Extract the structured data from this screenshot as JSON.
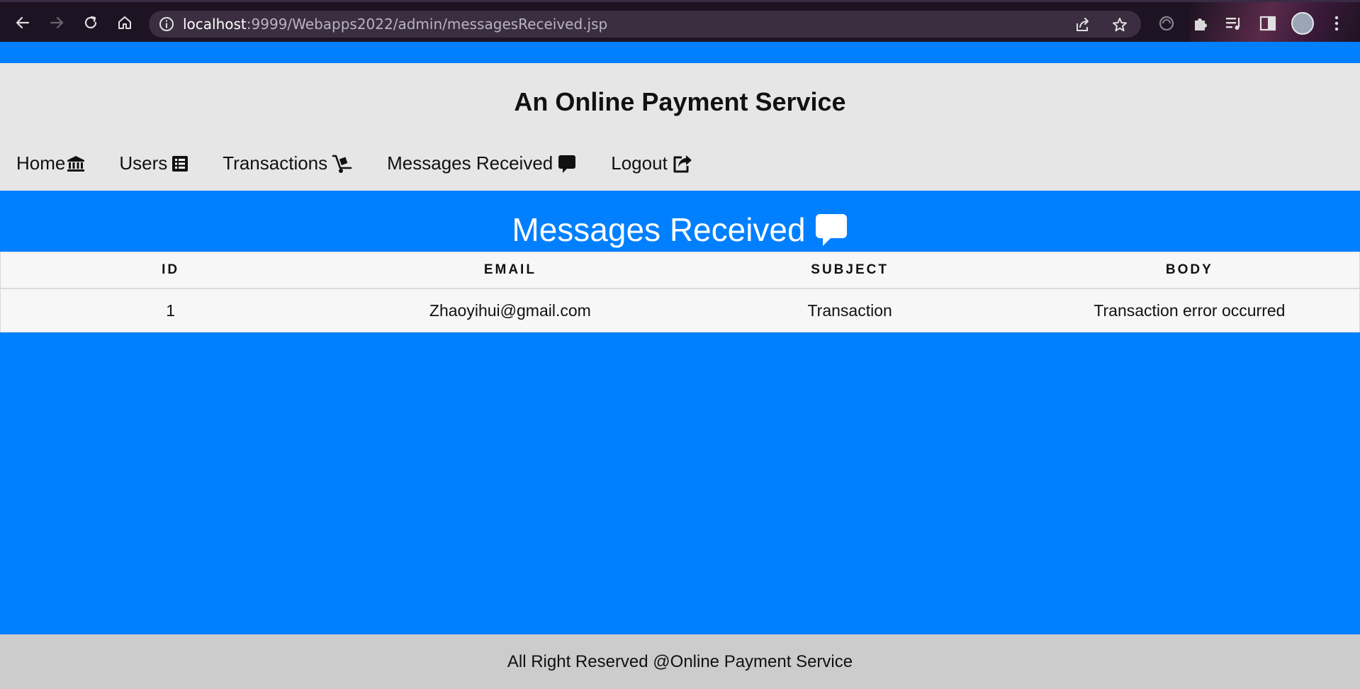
{
  "browser": {
    "url_host": "localhost",
    "url_path": ":9999/Webapps2022/admin/messagesReceived.jsp"
  },
  "site": {
    "title": "An Online Payment Service"
  },
  "nav": {
    "items": [
      {
        "label": "Home",
        "icon": "bank-icon"
      },
      {
        "label": "Users",
        "icon": "list-icon"
      },
      {
        "label": "Transactions",
        "icon": "dolly-icon"
      },
      {
        "label": "Messages Received",
        "icon": "comment-icon"
      },
      {
        "label": "Logout",
        "icon": "share-icon"
      }
    ]
  },
  "section": {
    "title": "Messages Received"
  },
  "table": {
    "columns": [
      "ID",
      "EMAIL",
      "SUBJECT",
      "BODY"
    ],
    "rows": [
      [
        "1",
        "Zhaoyihui@gmail.com",
        "Transaction",
        "Transaction error occurred"
      ]
    ]
  },
  "footer": {
    "text": "All Right Reserved @Online Payment Service"
  },
  "colors": {
    "page_background": "#0080ff",
    "header_background": "#e6e6e6",
    "footer_background": "#cccccc"
  }
}
